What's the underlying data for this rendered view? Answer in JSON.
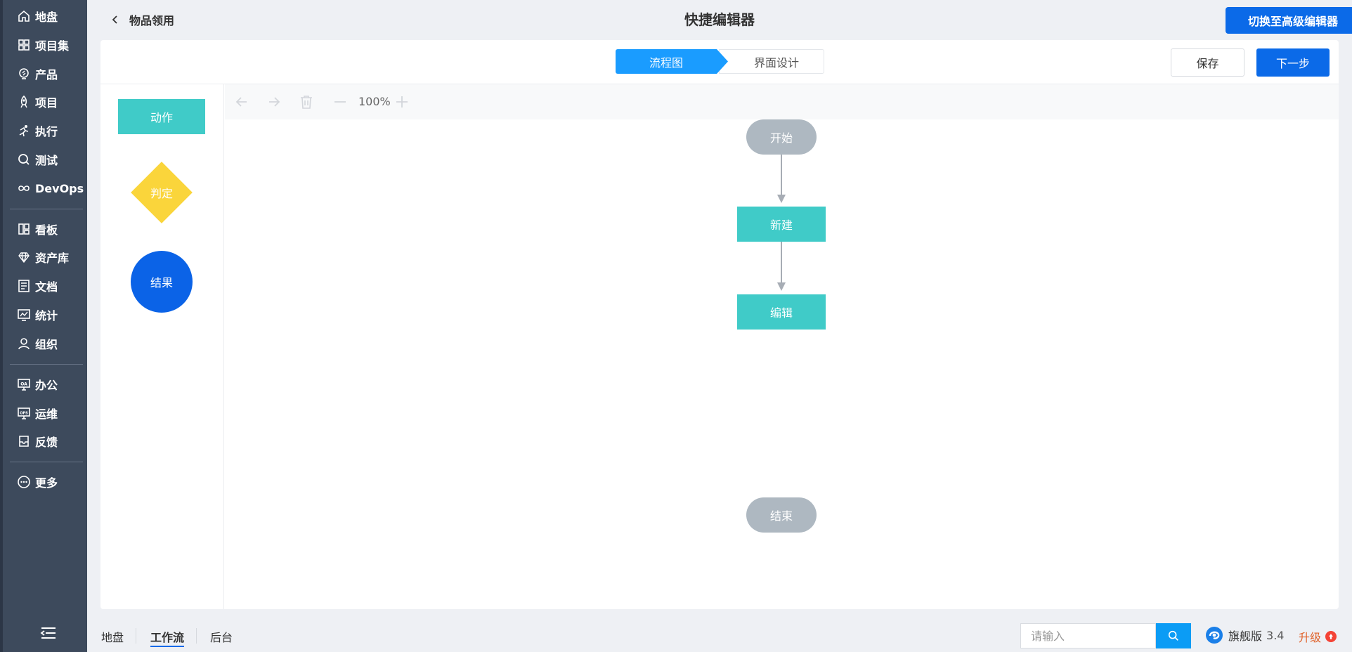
{
  "sidebar": {
    "items": [
      {
        "label": "地盘",
        "icon": "home-icon"
      },
      {
        "label": "项目集",
        "icon": "grid-icon"
      },
      {
        "label": "产品",
        "icon": "bulb-icon"
      },
      {
        "label": "项目",
        "icon": "rocket-icon"
      },
      {
        "label": "执行",
        "icon": "run-icon"
      },
      {
        "label": "测试",
        "icon": "search-icon"
      },
      {
        "label": "DevOps",
        "icon": "infinity-icon"
      },
      {
        "label": "看板",
        "icon": "kanban-icon"
      },
      {
        "label": "资产库",
        "icon": "diamond-icon"
      },
      {
        "label": "文档",
        "icon": "doc-icon"
      },
      {
        "label": "统计",
        "icon": "chart-icon"
      },
      {
        "label": "组织",
        "icon": "user-icon"
      },
      {
        "label": "办公",
        "icon": "oa-icon"
      },
      {
        "label": "运维",
        "icon": "ops-icon"
      },
      {
        "label": "反馈",
        "icon": "feedback-icon"
      },
      {
        "label": "更多",
        "icon": "more-icon"
      }
    ]
  },
  "header": {
    "back_label": "物品领用",
    "title": "快捷编辑器",
    "switch_label": "切换至高级编辑器"
  },
  "steps": {
    "active": "流程图",
    "next": "界面设计"
  },
  "actions": {
    "save": "保存",
    "next": "下一步"
  },
  "palette": {
    "action": "动作",
    "decision": "判定",
    "result": "结果"
  },
  "toolbar": {
    "zoom": "100%"
  },
  "flow": {
    "start": "开始",
    "node1": "新建",
    "node2": "编辑",
    "end": "结束"
  },
  "footer": {
    "tabs": [
      "地盘",
      "工作流",
      "后台"
    ],
    "active_tab": "工作流",
    "search_placeholder": "请输入",
    "edition": "旗舰版",
    "version": "3.4",
    "upgrade": "升级"
  },
  "colors": {
    "sidebar": "#3d4a5c",
    "primary": "#0b6ae8",
    "step_active": "#1a9cff",
    "action": "#40cbc8",
    "decision": "#fad53b",
    "result": "#0b63e7",
    "terminal": "#aeb8c1"
  }
}
